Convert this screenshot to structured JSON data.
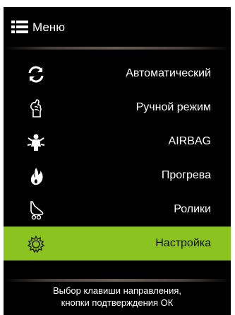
{
  "header": {
    "title": "Меню"
  },
  "items": [
    {
      "label": "Автоматический",
      "icon": "refresh-icon"
    },
    {
      "label": "Ручной режим",
      "icon": "hand-icon"
    },
    {
      "label": "AIRBAG",
      "icon": "airbag-icon"
    },
    {
      "label": "Прогрева",
      "icon": "flame-icon"
    },
    {
      "label": "Ролики",
      "icon": "roller-icon"
    },
    {
      "label": "Настройка",
      "icon": "gear-icon",
      "active": true
    }
  ],
  "footer": {
    "line1": "Выбор клавиши направления,",
    "line2": "кнопки подтверждения ОК"
  },
  "colors": {
    "active_bg": "#8bc420",
    "menu_bg": "#000000"
  }
}
